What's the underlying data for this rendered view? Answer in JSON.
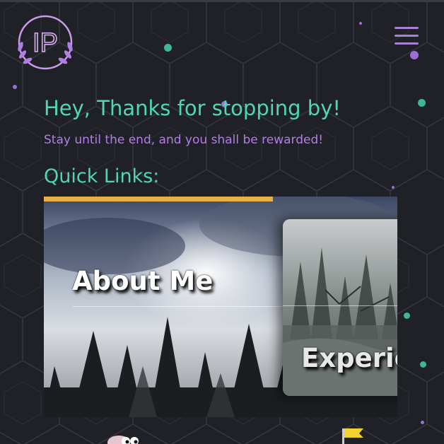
{
  "header": {
    "logo_text": "IP",
    "logo_icon": "laurel-wreath-monogram-icon",
    "menu_icon": "hamburger-menu-icon"
  },
  "intro": {
    "greeting": "Hey, Thanks for stopping by!",
    "subtitle": "Stay until the end, and you shall be rewarded!"
  },
  "quick_links": {
    "title": "Quick Links:",
    "cards": [
      {
        "label": "About Me",
        "image": "misty-forest-photo"
      },
      {
        "label": "Experie",
        "image": "forest-river-photo"
      }
    ]
  },
  "colors": {
    "background": "#1f2127",
    "heading": "#4fd6b4",
    "subtitle": "#b07fe6",
    "accent_bar": "#e9b046",
    "logo": "#c79be8"
  }
}
